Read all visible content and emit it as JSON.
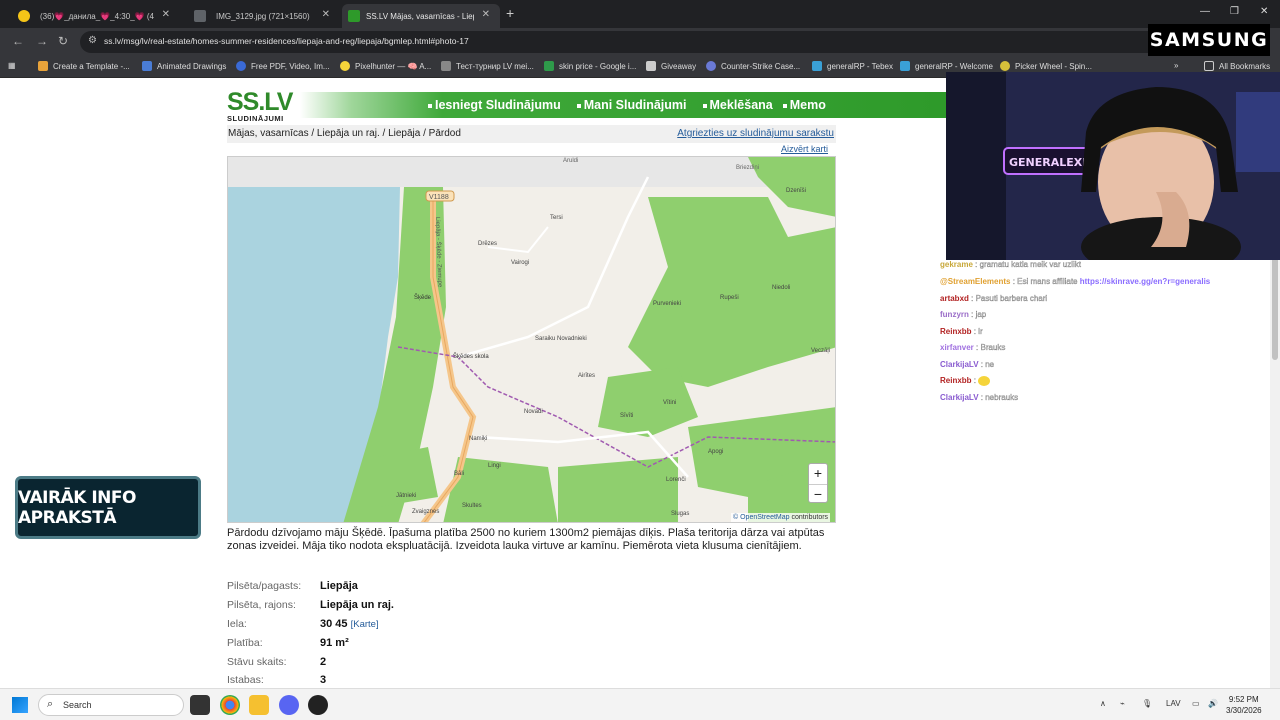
{
  "tabs": [
    {
      "label": "(36)💗_данила_💗_4:30_💗 (4"
    },
    {
      "label": "IMG_3129.jpg (721×1560)"
    },
    {
      "label": "SS.LV Mājas, vasarnīcas - Liepāj"
    }
  ],
  "url": "ss.lv/msg/lv/real-estate/homes-summer-residences/liepaja-and-reg/liepaja/bgmlep.html#photo-17",
  "samsung": "SAMSUNG",
  "bookmarks": [
    "Create a Template -...",
    "Animated Drawings",
    "Free PDF, Video, Im...",
    "Pixelhunter — 🧠 A...",
    "Тест-турнир LV mei...",
    "skin price - Google i...",
    "Giveaway",
    "Counter-Strike Case...",
    "generalRP - Tebex",
    "generalRP - Welcome",
    "Picker Wheel - Spin...",
    "All Bookmarks"
  ],
  "site": {
    "logo": "SS.LV",
    "logo_sub": "SLUDINĀJUMI",
    "nav": [
      "Iesniegt Sludinājumu",
      "Mani Sludinājumi",
      "Meklēšana",
      "Memo"
    ],
    "breadcrumb": "Mājas, vasarnīcas / Liepāja un raj. / Liepāja / Pārdod",
    "back_link": "Atgriezties uz sludinājumu sarakstu",
    "close_map": "Aizvērt karti"
  },
  "map": {
    "places": [
      "Aruldi",
      "Briezdiņi",
      "Dzenīši",
      "Tersi",
      "Drēzes",
      "Vairogi",
      "Šķēde",
      "Purvenieki",
      "Rupeši",
      "Niedoli",
      "Saraiku Novadnieki",
      "Šķēdes skola",
      "Veczāļi",
      "Airītes",
      "Novadi",
      "Sīvīti",
      "Vītini",
      "Namiķi",
      "Lingi",
      "Apogi",
      "Lorenči",
      "Bāli",
      "Jātnieki",
      "Zvaigznes",
      "Skultes",
      "Slugas"
    ],
    "road_label": "V1188",
    "road_name": "Liepāja - Šķēde - Ziemupe",
    "zoom_in": "+",
    "zoom_out": "−",
    "attribution_link": "© OpenStreetMap",
    "attribution_rest": " contributors"
  },
  "description": "Pārdodu dzīvojamo māju Šķēdē. Īpašuma platība 2500 no kuriem 1300m2 piemājas dīķis. Plaša teritorija dārza vai atpūtas zonas izveidei. Māja tiko nodota ekspluatācijā. Izveidota lauka virtuve ar kamīnu. Piemērota vieta klusuma cienītājiem.",
  "properties": [
    {
      "key": "Pilsēta/pagasts:",
      "value": "Liepāja"
    },
    {
      "key": "Pilsēta, rajons:",
      "value": "Liepāja un raj."
    },
    {
      "key": "Iela:",
      "value": "30 45",
      "link": "[Karte]"
    },
    {
      "key": "Platība:",
      "value": "91 m²"
    },
    {
      "key": "Stāvu skaits:",
      "value": "2"
    },
    {
      "key": "Istabas:",
      "value": "3"
    }
  ],
  "webcam": {
    "sign": "GENERALEXE"
  },
  "chat": [
    {
      "name": "gekrame",
      "text": ": gramatu katla meik var uzlikt",
      "color": "#c8a83a"
    },
    {
      "name": "@StreamElements",
      "text": ": Esi mans affiliate",
      "link": "https://skinrave.gg/en?r=generalis",
      "color": "#e0a030"
    },
    {
      "name": "artabxd",
      "text": ": Pasuti barbera chari",
      "color": "#b22222"
    },
    {
      "name": "funzyrn",
      "text": ": jap",
      "color": "#9a6cc8"
    },
    {
      "name": "Reinxbb",
      "text": ": lr",
      "color": "#b22222"
    },
    {
      "name": "xirfanver",
      "text": ": Brauks",
      "color": "#a070e0"
    },
    {
      "name": "ClarkijaLV",
      "text": ": ne",
      "color": "#8a5cd0"
    },
    {
      "name": "Reinxbb",
      "text": ":",
      "color": "#b22222"
    },
    {
      "name": "ClarkijaLV",
      "text": ": nebrauks",
      "color": "#8a5cd0"
    }
  ],
  "overlay_button": "VAIRĀK INFO APRAKSTĀ",
  "taskbar": {
    "search": "Search",
    "lang": "LAV",
    "time": "9:52 PM",
    "date": "3/30/2026"
  }
}
